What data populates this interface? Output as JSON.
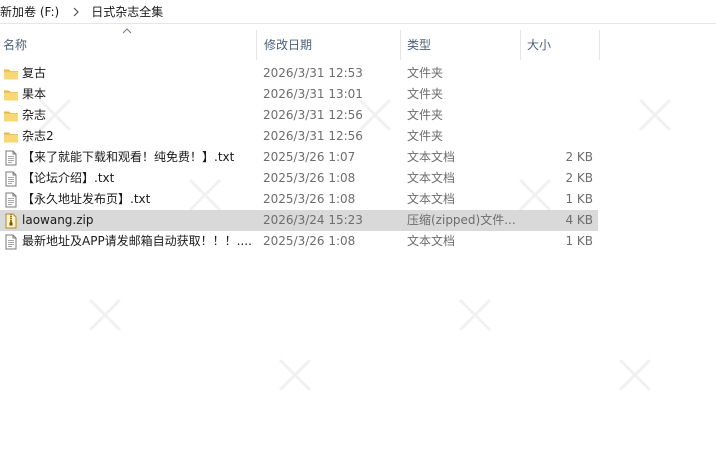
{
  "window": {
    "breadcrumb": [
      {
        "label": "新加卷 (F:)"
      },
      {
        "label": "日式杂志全集"
      }
    ]
  },
  "columns": {
    "name": "名称",
    "date": "修改日期",
    "type": "类型",
    "size": "大小"
  },
  "sort": {
    "column": "name",
    "direction": "ascending"
  },
  "colors": {
    "folder": "#f8d775",
    "folder_dark": "#e8b647",
    "selected_row": "#d9d9d9",
    "header_text": "#4c607a",
    "secondary_text": "#6d6d6d"
  },
  "files": [
    {
      "name": "复古",
      "date": "2026/3/31 12:53",
      "type": "文件夹",
      "size": "",
      "icon": "folder-icon",
      "selected": false
    },
    {
      "name": "果本",
      "date": "2026/3/31 13:01",
      "type": "文件夹",
      "size": "",
      "icon": "folder-icon",
      "selected": false
    },
    {
      "name": "杂志",
      "date": "2026/3/31 12:56",
      "type": "文件夹",
      "size": "",
      "icon": "folder-icon",
      "selected": false
    },
    {
      "name": "杂志2",
      "date": "2026/3/31 12:56",
      "type": "文件夹",
      "size": "",
      "icon": "folder-icon",
      "selected": false
    },
    {
      "name": "【来了就能下载和观看！纯免费！】.txt",
      "date": "2025/3/26 1:07",
      "type": "文本文档",
      "size": "2 KB",
      "icon": "text-file-icon",
      "selected": false
    },
    {
      "name": "【论坛介绍】.txt",
      "date": "2025/3/26 1:08",
      "type": "文本文档",
      "size": "2 KB",
      "icon": "text-file-icon",
      "selected": false
    },
    {
      "name": "【永久地址发布页】.txt",
      "date": "2025/3/26 1:08",
      "type": "文本文档",
      "size": "1 KB",
      "icon": "text-file-icon",
      "selected": false
    },
    {
      "name": "laowang.zip",
      "date": "2026/3/24 15:23",
      "type": "压缩(zipped)文件...",
      "size": "4 KB",
      "icon": "zip-file-icon",
      "selected": true
    },
    {
      "name": "最新地址及APP请发邮箱自动获取！！！....",
      "date": "2025/3/26 1:08",
      "type": "文本文档",
      "size": "1 KB",
      "icon": "text-file-icon",
      "selected": false
    }
  ]
}
